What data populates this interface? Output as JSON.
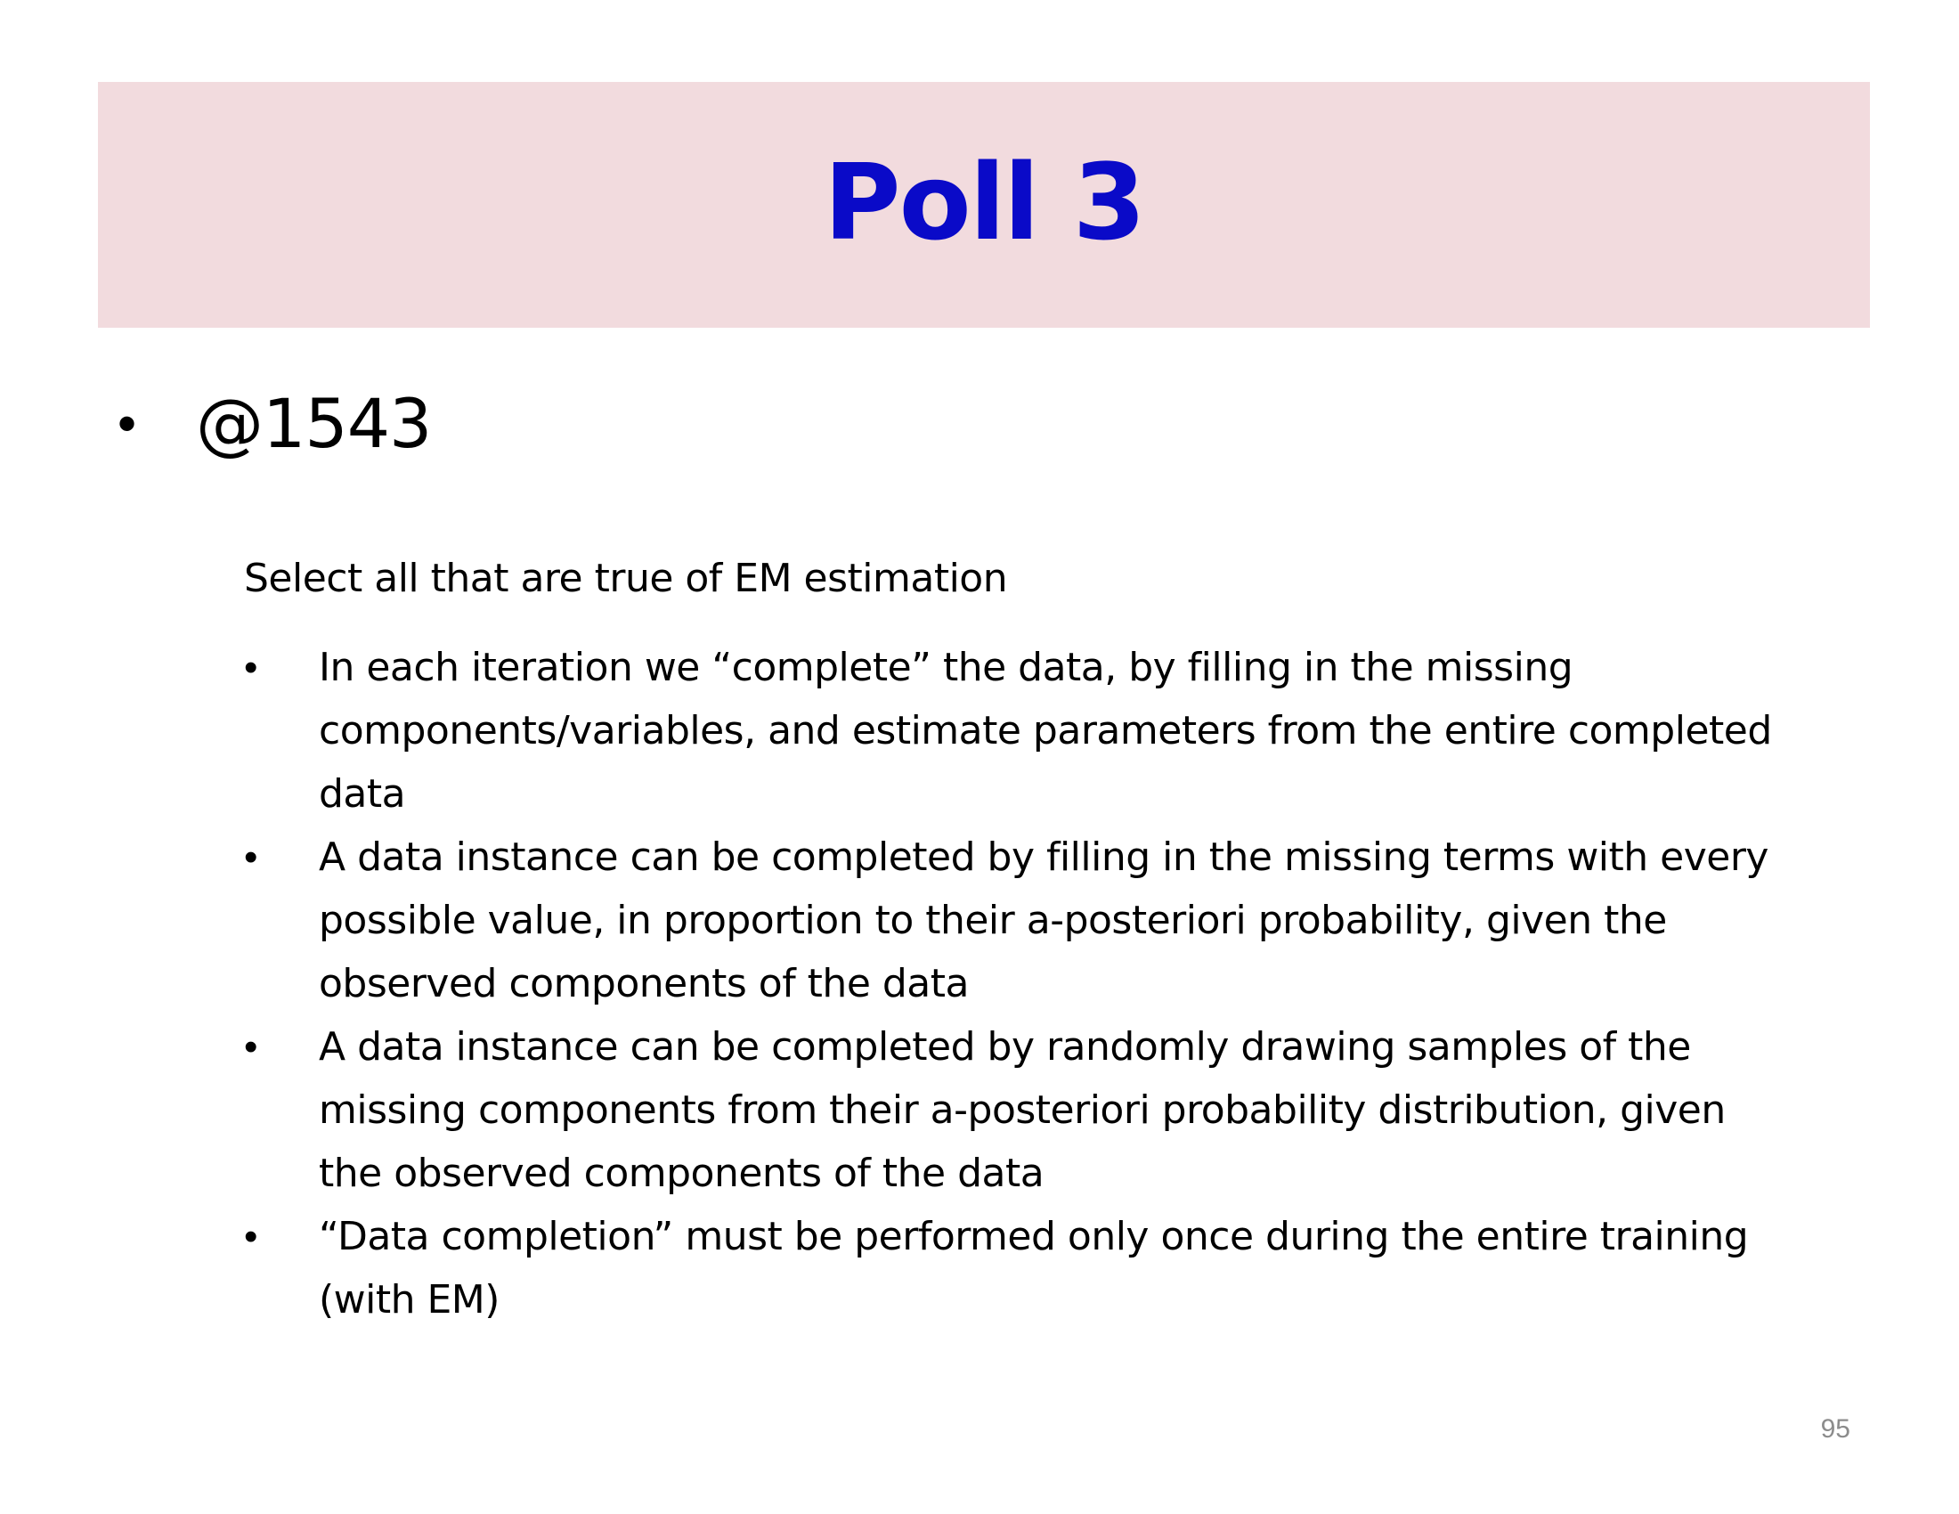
{
  "slide": {
    "title": "Poll 3",
    "main_bullet": {
      "bullet": "•",
      "text": "@1543"
    },
    "question": "Select all that are true of EM estimation",
    "options": [
      {
        "bullet": "•",
        "text": "In each iteration we “complete” the data, by filling in the missing components/variables, and estimate parameters from the entire completed data"
      },
      {
        "bullet": "•",
        "text": "A data instance can be completed by filling in the missing terms with every possible value, in proportion to their a-posteriori probability, given the observed components of the data"
      },
      {
        "bullet": "•",
        "text": "A data instance can be completed by randomly drawing samples of the missing components from their a-posteriori probability distribution, given the observed components of the data"
      },
      {
        "bullet": "•",
        "text": "“Data completion” must be performed only once during the entire training (with EM)"
      }
    ],
    "page_number": "95"
  },
  "colors": {
    "title_bar_background": "#f2dbde",
    "title_text": "#0a0ac8",
    "body_text": "#000000",
    "page_number": "#8c8c8c"
  }
}
